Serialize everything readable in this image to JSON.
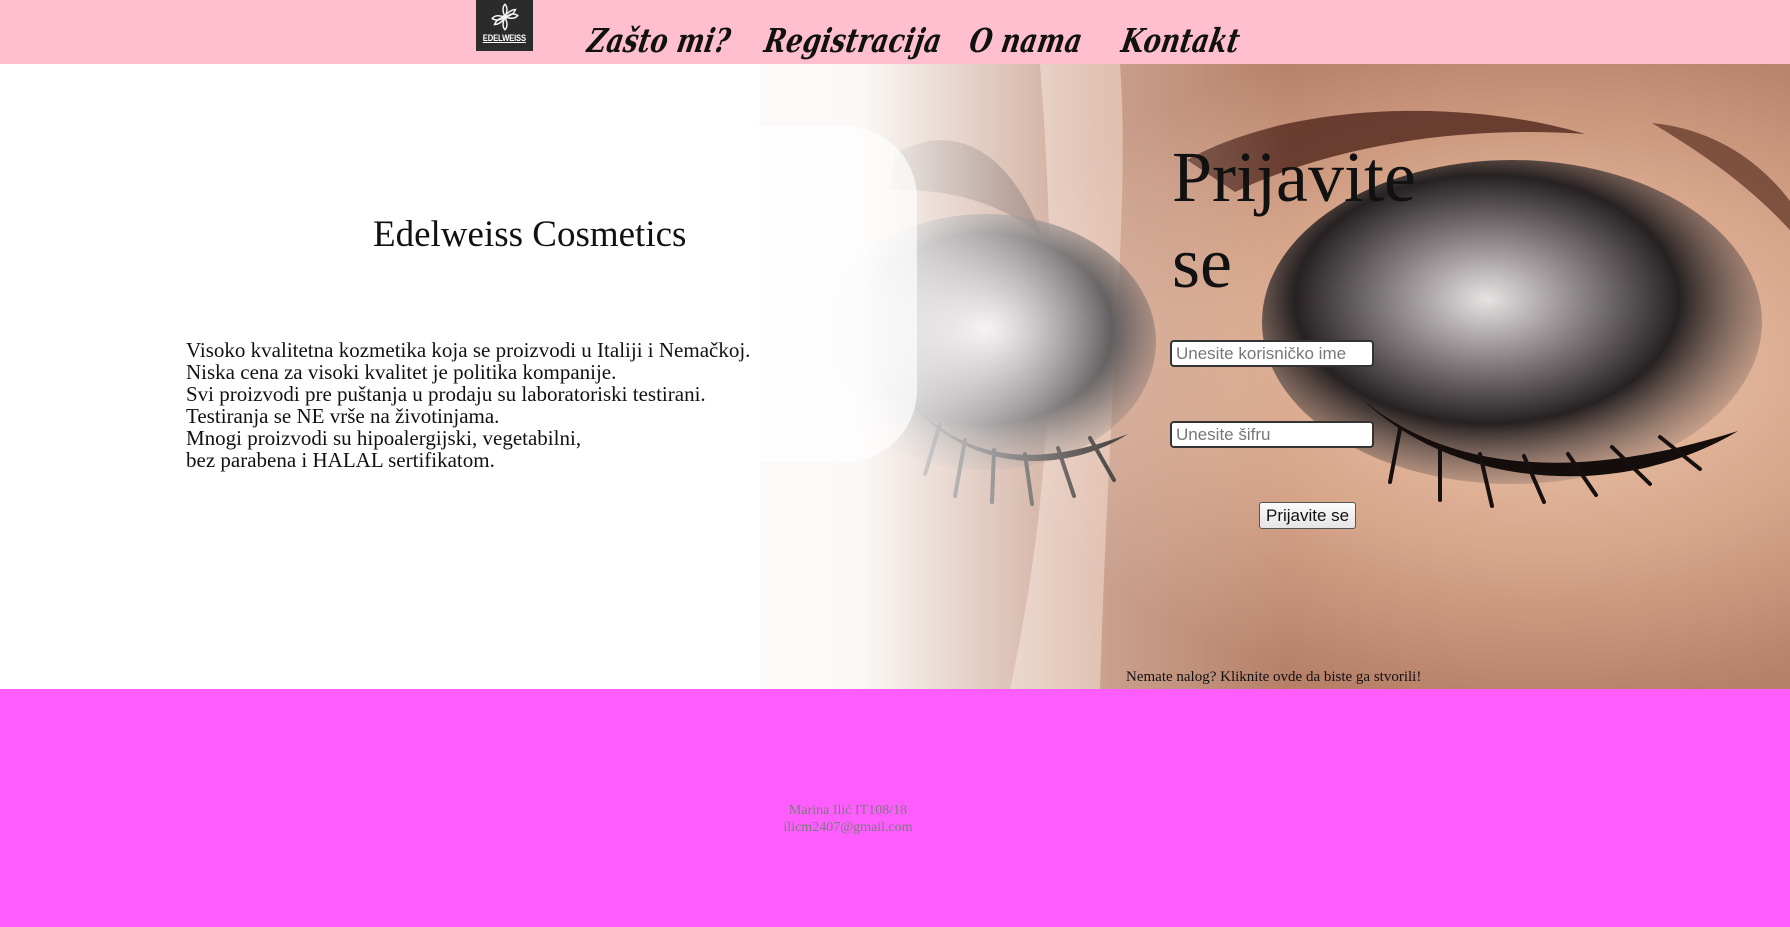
{
  "navbar": {
    "logo_text": "EDELWEISS",
    "links": [
      {
        "label": "Zašto mi?"
      },
      {
        "label": "Registracija"
      },
      {
        "label": "O nama"
      },
      {
        "label": "Kontakt"
      }
    ],
    "background": "#ffbfcf",
    "logo_icon": "flower-icon"
  },
  "hero": {
    "brand_title": "Edelweiss Cosmetics",
    "description_lines": [
      "Visoko kvalitetna kozmetika koja se proizvodi u Italiji i Nemačkoj.",
      "Niska cena za visoki kvalitet je politika kompanije.",
      "Svi proizvodi pre puštanja u prodaju su laboratoriski testirani.",
      "Testiranja se NE vrše na životinjama.",
      "Mnogi proizvodi su hipoalergijski, vegetabilni,",
      "bez parabena i HALAL sertifikatom."
    ],
    "image_subject": "closed eyes with smoky eye makeup"
  },
  "login": {
    "title": "Prijavite se",
    "username_placeholder": "Unesite korisničko ime",
    "password_placeholder": "Unesite šifru",
    "button_label": "Prijavite se",
    "signup_text": "Nemate nalog? Kliknite ovde da biste ga stvorili!"
  },
  "footer": {
    "author": "Marina Ilić IT108/18",
    "email": "ilicm2407@gmail.com",
    "background": "#ff5dff"
  }
}
